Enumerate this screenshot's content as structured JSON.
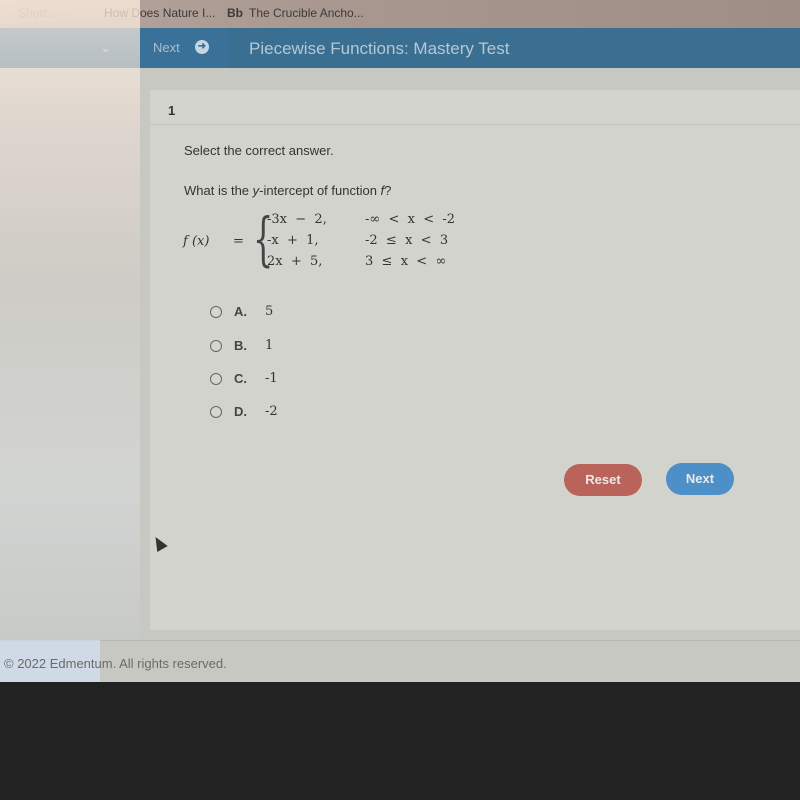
{
  "browser": {
    "bookmarks": [
      {
        "label": "Short..."
      },
      {
        "label": "How Does Nature I..."
      },
      {
        "label": "The Crucible Ancho...",
        "icon": "Bb"
      }
    ]
  },
  "topbar": {
    "nav_next_label": "Next",
    "nav_next_icon": "arrow-right-circle-icon",
    "chevron_icon": "chevron-down-icon",
    "title": "Piecewise Functions: Mastery Test",
    "accent": "#3b6f92"
  },
  "question": {
    "number": "1",
    "instruction": "Select the correct answer.",
    "prompt_pre": "What is the ",
    "prompt_var": "y",
    "prompt_mid": "-intercept of function ",
    "prompt_fn": "f",
    "prompt_post": "?",
    "function": {
      "lhs": "f (x)",
      "eq": "=",
      "pieces": [
        {
          "expr": "-3x  −  2,",
          "condition": "-∞  <  x  <  -2"
        },
        {
          "expr": "-x  +  1,",
          "condition": "-2  ≤  x  <  3"
        },
        {
          "expr": "2x  +  5,",
          "condition": "3  ≤  x  <  ∞"
        }
      ]
    },
    "choices": [
      {
        "letter": "A.",
        "value": "5"
      },
      {
        "letter": "B.",
        "value": "1"
      },
      {
        "letter": "C.",
        "value": "-1"
      },
      {
        "letter": "D.",
        "value": "-2"
      }
    ]
  },
  "actions": {
    "reset_label": "Reset",
    "next_label": "Next",
    "reset_color": "#b9635a",
    "next_color": "#4d8fc7"
  },
  "footer": {
    "copyright": "© 2022 Edmentum. All rights reserved."
  }
}
